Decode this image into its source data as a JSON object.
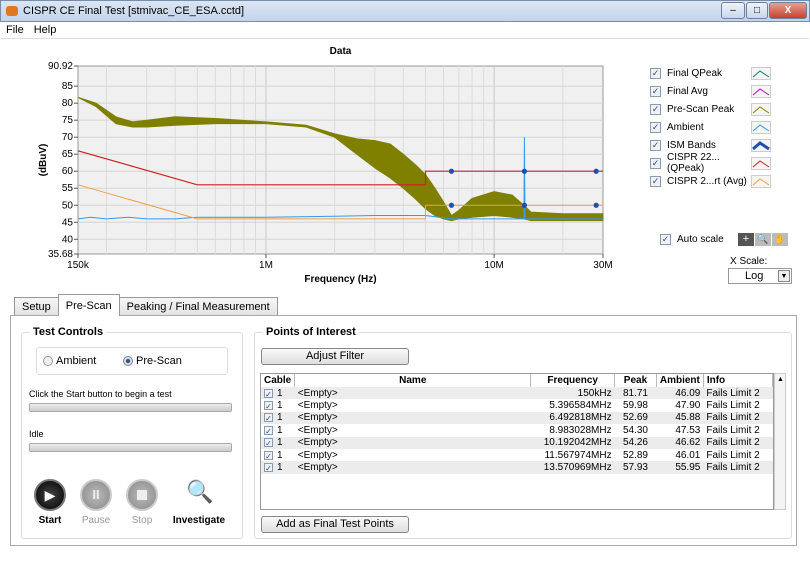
{
  "window": {
    "title": "CISPR CE Final Test [stmivac_CE_ESA.cctd]",
    "minimize": "–",
    "maximize": "□",
    "close": "X"
  },
  "menu": [
    "File",
    "Help"
  ],
  "chart_data": {
    "type": "line",
    "title": "Data",
    "xlabel": "Frequency (Hz)",
    "ylabel": "(dBuV)",
    "xscale": "log",
    "xlim": [
      150000,
      30000000
    ],
    "ylim": [
      35.68,
      90.92
    ],
    "grid": true,
    "xticks": [
      {
        "v": 150000,
        "l": "150k"
      },
      {
        "v": 1000000,
        "l": "1M"
      },
      {
        "v": 10000000,
        "l": "10M"
      },
      {
        "v": 30000000,
        "l": "30M"
      }
    ],
    "yticks": [
      {
        "v": 90.92,
        "l": "90.92"
      },
      {
        "v": 85,
        "l": "85"
      },
      {
        "v": 80,
        "l": "80"
      },
      {
        "v": 75,
        "l": "75"
      },
      {
        "v": 70,
        "l": "70"
      },
      {
        "v": 65,
        "l": "65"
      },
      {
        "v": 60,
        "l": "60"
      },
      {
        "v": 55,
        "l": "55"
      },
      {
        "v": 50,
        "l": "50"
      },
      {
        "v": 45,
        "l": "45"
      },
      {
        "v": 40,
        "l": "40"
      },
      {
        "v": 35.68,
        "l": "35.68"
      }
    ],
    "series": [
      {
        "name": "CISPR 22...(QPeak)",
        "color": "#d02020",
        "x": [
          150000,
          500000,
          5000000,
          5000000,
          30000000
        ],
        "y": [
          66,
          56,
          56,
          60,
          60
        ]
      },
      {
        "name": "CISPR 2...rt (Avg)",
        "color": "#f0a040",
        "x": [
          150000,
          500000,
          5000000,
          5000000,
          30000000
        ],
        "y": [
          56,
          46,
          46,
          50,
          50
        ]
      },
      {
        "name": "Ambient",
        "color": "#3399ee",
        "x": [
          150000,
          170000,
          200000,
          250000,
          300000,
          400000,
          500000,
          700000,
          1000000,
          2000000,
          3000000,
          5000000,
          6500000,
          8000000,
          13500000,
          13570969,
          13650000,
          20000000,
          30000000
        ],
        "y": [
          46,
          46.5,
          46,
          46.5,
          46,
          46,
          46.5,
          46.5,
          46.5,
          46.8,
          47,
          47,
          46,
          46,
          46,
          70,
          46,
          46,
          46
        ]
      },
      {
        "name": "Pre-Scan Peak",
        "color": "#808000",
        "band": true,
        "x_upper": [
          150000,
          180000,
          220000,
          260000,
          300000,
          400000,
          600000,
          1000000,
          1500000,
          2000000,
          2500000,
          3000000,
          3500000,
          4000000,
          4500000,
          5000000,
          5500000,
          6000000,
          6500000,
          7000000,
          8000000,
          10000000,
          12000000,
          13500000,
          14500000,
          20000000,
          30000000
        ],
        "y_upper": [
          81.7,
          80,
          76,
          74.5,
          75,
          76,
          75.5,
          74.5,
          73.5,
          71,
          69.5,
          69,
          68,
          65,
          62,
          59,
          55,
          51,
          47,
          48.5,
          52,
          54,
          53,
          50,
          48,
          47.5,
          47.5
        ],
        "x_lower": [
          150000,
          180000,
          220000,
          260000,
          300000,
          400000,
          600000,
          1000000,
          1500000,
          2000000,
          2500000,
          3000000,
          3500000,
          4000000,
          4500000,
          5000000,
          5500000,
          6000000,
          6500000,
          7000000,
          8000000,
          10000000,
          12000000,
          13500000,
          14500000,
          20000000,
          30000000
        ],
        "y_lower": [
          81.7,
          79,
          74,
          73,
          73,
          73.5,
          74,
          74,
          73,
          70,
          65,
          61,
          58,
          55,
          52,
          49,
          47,
          46,
          45.5,
          46,
          46.5,
          47,
          46.5,
          46,
          45.5,
          45.5,
          45.5
        ]
      },
      {
        "name": "Final QPeak",
        "color": "#1f4fb0",
        "markers": true,
        "x": [
          6500000,
          13570969,
          28000000
        ],
        "y": [
          60,
          60,
          60
        ]
      },
      {
        "name": "Final Avg",
        "color": "#1f4fb0",
        "markers": true,
        "x": [
          6500000,
          13570969,
          28000000
        ],
        "y": [
          50,
          50,
          50
        ]
      }
    ]
  },
  "legend": [
    {
      "label": "Final QPeak",
      "checked": true,
      "color": "#008080"
    },
    {
      "label": "Final Avg",
      "checked": true,
      "color": "#cc00cc"
    },
    {
      "label": "Pre-Scan Peak",
      "checked": true,
      "color": "#808000"
    },
    {
      "label": "Ambient",
      "checked": true,
      "color": "#3399ee"
    },
    {
      "label": "ISM Bands",
      "checked": true,
      "color": "#1f4fb0"
    },
    {
      "label": "CISPR 22...(QPeak)",
      "checked": true,
      "color": "#d02020"
    },
    {
      "label": "CISPR 2...rt (Avg)",
      "checked": true,
      "color": "#f0a040"
    }
  ],
  "graph_controls": {
    "auto_scale": "Auto scale",
    "auto_scale_checked": true,
    "x_scale_label": "X Scale:",
    "x_scale_value": "Log"
  },
  "tabs": [
    {
      "label": "Setup"
    },
    {
      "label": "Pre-Scan",
      "active": true
    },
    {
      "label": "Peaking / Final Measurement"
    }
  ],
  "test_controls": {
    "title": "Test Controls",
    "radio_ambient": "Ambient",
    "radio_prescan": "Pre-Scan",
    "selected": "Pre-Scan",
    "status1": "Click the Start button to begin a test",
    "status2": "Idle",
    "progress1": 0,
    "progress2": 0,
    "start": "Start",
    "pause": "Pause",
    "stop": "Stop",
    "investigate": "Investigate"
  },
  "poi": {
    "title": "Points of Interest",
    "adjust_filter": "Adjust Filter",
    "add_final": "Add as Final Test Points",
    "columns": [
      "Cable",
      "Name",
      "Frequency",
      "Peak",
      "Ambient",
      "Info"
    ],
    "rows": [
      {
        "cable": "1",
        "name": "<Empty>",
        "freq": "150kHz",
        "peak": "81.71",
        "ambient": "46.09",
        "info": "Fails Limit 2"
      },
      {
        "cable": "1",
        "name": "<Empty>",
        "freq": "5.396584MHz",
        "peak": "59.98",
        "ambient": "47.90",
        "info": "Fails Limit 2"
      },
      {
        "cable": "1",
        "name": "<Empty>",
        "freq": "6.492818MHz",
        "peak": "52.69",
        "ambient": "45.88",
        "info": "Fails Limit 2"
      },
      {
        "cable": "1",
        "name": "<Empty>",
        "freq": "8.983028MHz",
        "peak": "54.30",
        "ambient": "47.53",
        "info": "Fails Limit 2"
      },
      {
        "cable": "1",
        "name": "<Empty>",
        "freq": "10.192042MHz",
        "peak": "54.26",
        "ambient": "46.62",
        "info": "Fails Limit 2"
      },
      {
        "cable": "1",
        "name": "<Empty>",
        "freq": "11.567974MHz",
        "peak": "52.89",
        "ambient": "46.01",
        "info": "Fails Limit 2"
      },
      {
        "cable": "1",
        "name": "<Empty>",
        "freq": "13.570969MHz",
        "peak": "57.93",
        "ambient": "55.95",
        "info": "Fails Limit 2"
      }
    ]
  }
}
